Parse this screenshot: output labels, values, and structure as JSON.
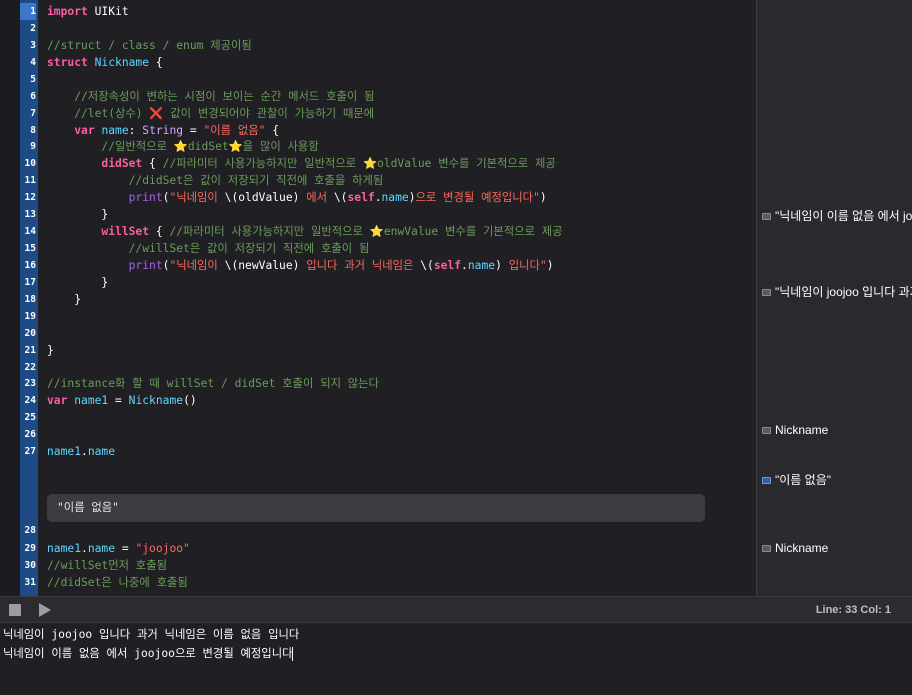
{
  "editor": {
    "lines": [
      {
        "num": "1",
        "segs": [
          [
            "kw",
            "import"
          ],
          [
            "pl",
            " UIKit"
          ]
        ]
      },
      {
        "num": "2",
        "segs": []
      },
      {
        "num": "3",
        "segs": [
          [
            "cm",
            "//struct / class / enum 제공이됨"
          ]
        ]
      },
      {
        "num": "4",
        "segs": [
          [
            "kw",
            "struct"
          ],
          [
            "pl",
            " "
          ],
          [
            "ty",
            "Nickname"
          ],
          [
            "pl",
            " {"
          ]
        ]
      },
      {
        "num": "5",
        "segs": []
      },
      {
        "num": "6",
        "segs": [
          [
            "cm",
            "    //저장속성이 변하는 시점이 보이는 순간 메서드 호출이 됨"
          ]
        ]
      },
      {
        "num": "7",
        "segs": [
          [
            "cm",
            "    //let(상수) "
          ],
          [
            "x",
            "❌"
          ],
          [
            "cm",
            " 값이 변경되어야 관찰이 가능하기 때문에"
          ]
        ]
      },
      {
        "num": "8",
        "segs": [
          [
            "pl",
            "    "
          ],
          [
            "kw",
            "var"
          ],
          [
            "pl",
            " "
          ],
          [
            "ty",
            "name"
          ],
          [
            "pl",
            ": "
          ],
          [
            "ty2",
            "String"
          ],
          [
            "pl",
            " = "
          ],
          [
            "str",
            "\"이름 없음\""
          ],
          [
            "pl",
            " {"
          ]
        ]
      },
      {
        "num": "9",
        "segs": [
          [
            "cm",
            "        //일반적으로 "
          ],
          [
            "emo",
            "⭐"
          ],
          [
            "cm",
            "didSet"
          ],
          [
            "emo",
            "⭐"
          ],
          [
            "cm",
            "을 많이 사용함"
          ]
        ]
      },
      {
        "num": "10",
        "segs": [
          [
            "pl",
            "        "
          ],
          [
            "kw",
            "didSet"
          ],
          [
            "pl",
            " { "
          ],
          [
            "cm",
            "//파라미터 사용가능하지만 일반적으로 "
          ],
          [
            "emo",
            "⭐"
          ],
          [
            "cm",
            "oldValue 변수를 기본적으로 제공"
          ]
        ]
      },
      {
        "num": "11",
        "segs": [
          [
            "cm",
            "            //didSet은 값이 저장되기 직전에 호출을 하게됨"
          ]
        ]
      },
      {
        "num": "12",
        "segs": [
          [
            "pl",
            "            "
          ],
          [
            "fn",
            "print"
          ],
          [
            "pl",
            "("
          ],
          [
            "str",
            "\"닉네임이 "
          ],
          [
            "pl",
            "\\(oldValue)"
          ],
          [
            "str",
            " 에서 "
          ],
          [
            "pl",
            "\\("
          ],
          [
            "kw",
            "self"
          ],
          [
            "pl",
            "."
          ],
          [
            "ty",
            "name"
          ],
          [
            "pl",
            ")"
          ],
          [
            "str",
            "으로 변경될 예정입니다\""
          ],
          [
            "pl",
            ")"
          ]
        ]
      },
      {
        "num": "13",
        "segs": [
          [
            "pl",
            "        }"
          ]
        ]
      },
      {
        "num": "14",
        "segs": [
          [
            "pl",
            "        "
          ],
          [
            "kw",
            "willSet"
          ],
          [
            "pl",
            " { "
          ],
          [
            "cm",
            "//파라미터 사용가능하지만 일반적으로 "
          ],
          [
            "emo",
            "⭐"
          ],
          [
            "cm",
            "enwValue 변수를 기본적으로 제공"
          ]
        ]
      },
      {
        "num": "15",
        "segs": [
          [
            "cm",
            "            //willSet은 값이 저장되기 직전에 호출이 됨"
          ]
        ]
      },
      {
        "num": "16",
        "segs": [
          [
            "pl",
            "            "
          ],
          [
            "fn",
            "print"
          ],
          [
            "pl",
            "("
          ],
          [
            "str",
            "\"닉네임이 "
          ],
          [
            "pl",
            "\\(newValue)"
          ],
          [
            "str",
            " 입니다 과거 닉네임은 "
          ],
          [
            "pl",
            "\\("
          ],
          [
            "kw",
            "self"
          ],
          [
            "pl",
            "."
          ],
          [
            "ty",
            "name"
          ],
          [
            "pl",
            ")"
          ],
          [
            "str",
            " 입니다\""
          ],
          [
            "pl",
            ")"
          ]
        ]
      },
      {
        "num": "17",
        "segs": [
          [
            "pl",
            "        }"
          ]
        ]
      },
      {
        "num": "18",
        "segs": [
          [
            "pl",
            "    }"
          ]
        ]
      },
      {
        "num": "19",
        "segs": []
      },
      {
        "num": "20",
        "segs": []
      },
      {
        "num": "21",
        "segs": [
          [
            "pl",
            "}"
          ]
        ]
      },
      {
        "num": "22",
        "segs": []
      },
      {
        "num": "23",
        "segs": [
          [
            "cm",
            "//instance화 할 때 willSet / didSet 호출이 되지 않는다"
          ]
        ]
      },
      {
        "num": "24",
        "segs": [
          [
            "kw",
            "var"
          ],
          [
            "pl",
            " "
          ],
          [
            "ty",
            "name1"
          ],
          [
            "pl",
            " = "
          ],
          [
            "ty",
            "Nickname"
          ],
          [
            "pl",
            "()"
          ]
        ]
      },
      {
        "num": "25",
        "segs": []
      },
      {
        "num": "26",
        "segs": []
      },
      {
        "num": "27",
        "segs": [
          [
            "ty",
            "name1"
          ],
          [
            "pl",
            "."
          ],
          [
            "ty",
            "name"
          ]
        ]
      },
      {
        "num": "28",
        "segs": []
      },
      {
        "num": "29",
        "segs": [
          [
            "ty",
            "name1"
          ],
          [
            "pl",
            "."
          ],
          [
            "ty",
            "name"
          ],
          [
            "pl",
            " = "
          ],
          [
            "str",
            "\"joojoo\""
          ]
        ]
      },
      {
        "num": "30",
        "segs": [
          [
            "cm",
            "//willSet먼저 호출됨"
          ]
        ]
      },
      {
        "num": "31",
        "segs": [
          [
            "cm",
            "//didSet은 나중에 호출됨"
          ]
        ]
      }
    ],
    "inline_result": "\"이름 없음\""
  },
  "results": [
    {
      "text": "\"닉네임이 이름 없음 에서 joojoo으로 변경될 예정입니다\"\n",
      "selected": false
    },
    {
      "text": "\"닉네임이 joojoo 입니다 과거 닉네임은 이름 없음 입니다\"\n",
      "selected": false
    },
    {
      "text": "Nickname",
      "selected": false
    },
    {
      "text": "\"이름 없음\"",
      "selected": true
    },
    {
      "text": "Nickname",
      "selected": false
    }
  ],
  "debug": {
    "cursor_position": "Line: 33  Col: 1"
  },
  "console": {
    "lines": [
      "닉네임이 joojoo 입니다 과거 닉네임은 이름 없음 입니다",
      "닉네임이 이름 없음 에서 joojoo으로 변경될 예정입니다"
    ]
  }
}
